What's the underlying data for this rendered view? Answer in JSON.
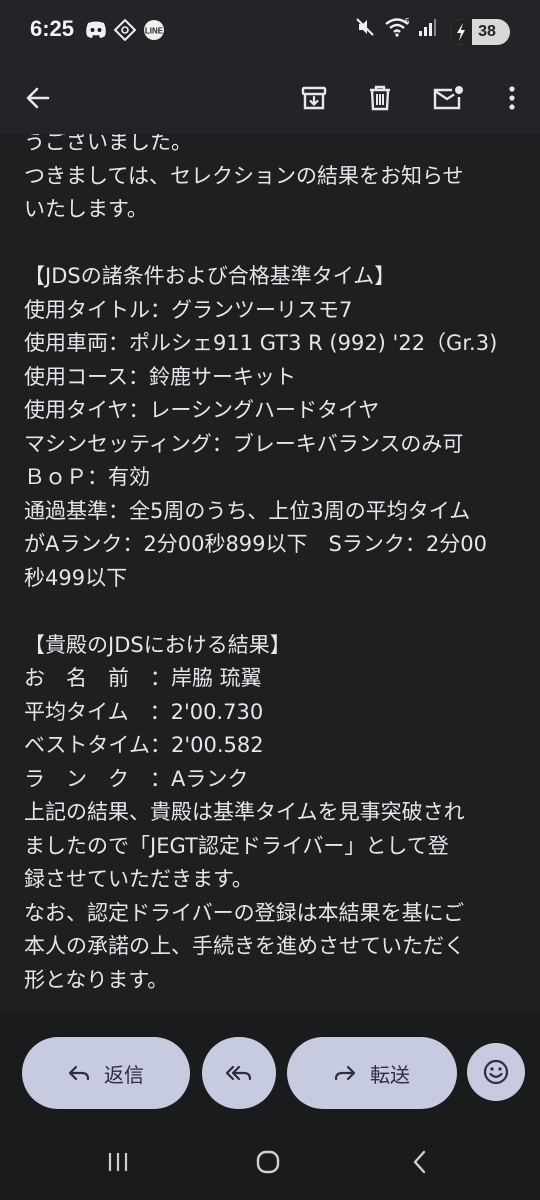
{
  "status_bar": {
    "time": "6:25",
    "battery": "38",
    "signal_label": "5",
    "line_icon_text": "LINE"
  },
  "toolbar": {
    "back": "back-arrow-icon",
    "archive": "archive-icon",
    "delete": "trash-icon",
    "unread": "mark-unread-icon",
    "more": "more-vert-icon"
  },
  "email": {
    "lines": [
      "うございました。",
      "つきましては、セレクションの結果をお知らせ",
      "いたします。",
      "",
      "【JDSの諸条件および合格基準タイム】",
      "使用タイトル：グランツーリスモ7",
      "使用車両：ポルシェ911 GT3 R (992) '22（Gr.3)",
      "使用コース：鈴鹿サーキット",
      "使用タイヤ：レーシングハードタイヤ",
      "マシンセッティング：ブレーキバランスのみ可",
      "ＢｏＰ：有効",
      "通過基準：全5周のうち、上位3周の平均タイム",
      "がAランク：2分00秒899以下　Sランク：2分00",
      "秒499以下",
      "",
      "【貴殿のJDSにおける結果】",
      "お　名　前　：岸脇 琉翼",
      "平均タイム　：2'00.730",
      "ベストタイム：2'00.582",
      "ラ　ン　ク　：Aランク",
      "上記の結果、貴殿は基準タイムを見事突破され",
      "ましたので「JEGT認定ドライバー」として登",
      "録させていただきます。",
      "なお、認定ドライバーの登録は本結果を基にご",
      "本人の承諾の上、手続きを進めさせていただく",
      "形となります。"
    ]
  },
  "actions": {
    "reply_label": "返信",
    "forward_label": "転送"
  },
  "colors": {
    "pill": "#c7cbe0",
    "background": "#1f1f21",
    "bar": "#232427"
  }
}
